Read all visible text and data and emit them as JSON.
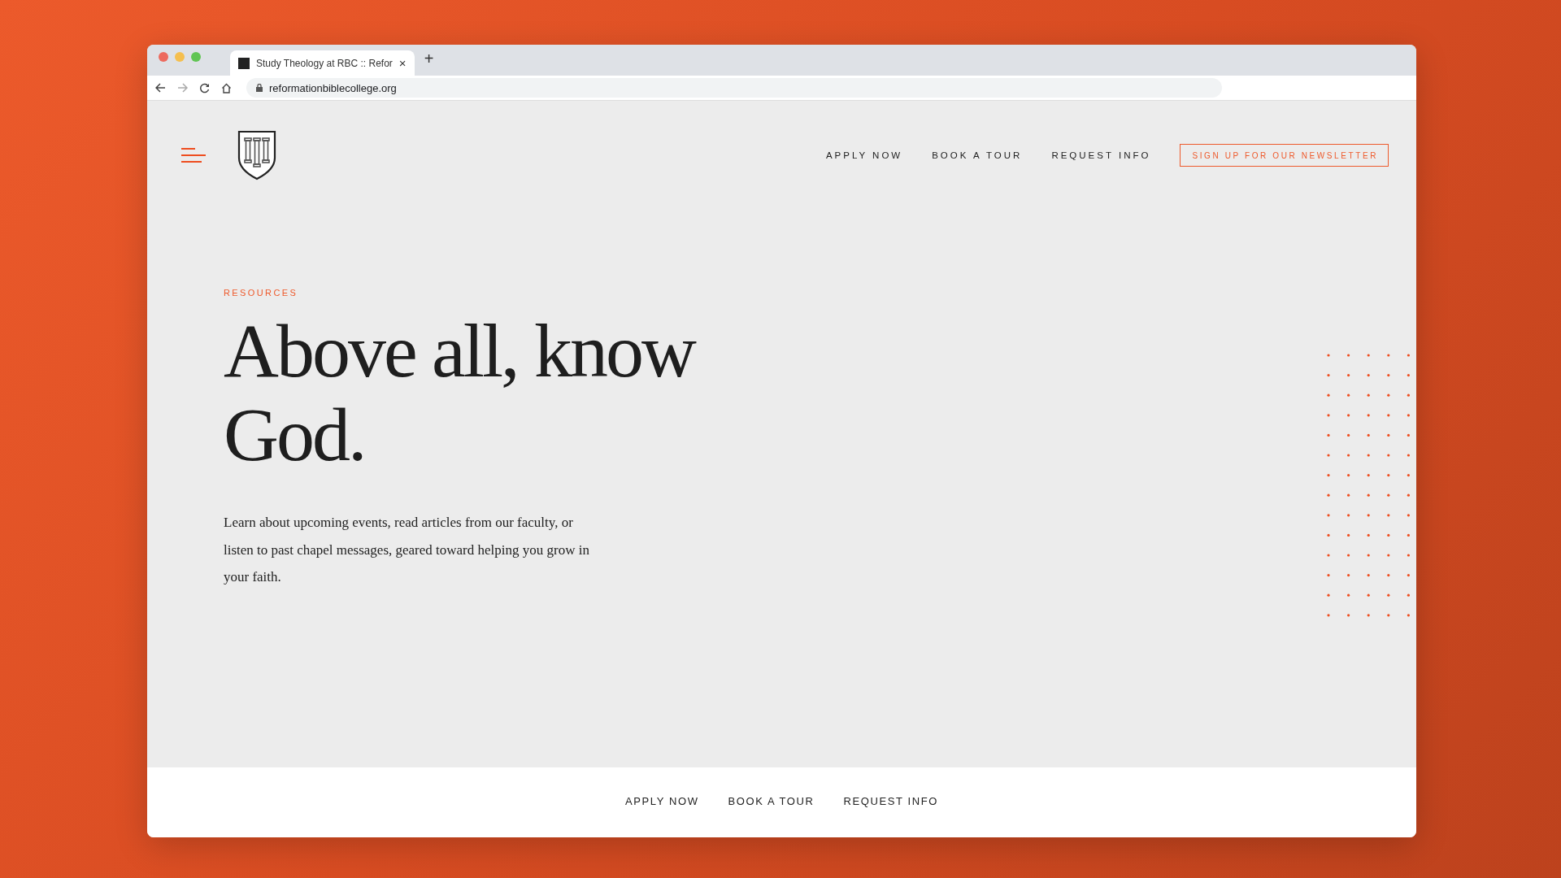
{
  "browser": {
    "tab_title": "Study Theology at RBC :: Refor",
    "tab_close": "×",
    "new_tab": "+",
    "url": "reformationbiblecollege.org"
  },
  "header": {
    "nav": [
      "APPLY NOW",
      "BOOK A TOUR",
      "REQUEST INFO"
    ],
    "newsletter_button": "SIGN UP FOR OUR NEWSLETTER"
  },
  "hero": {
    "eyebrow": "RESOURCES",
    "heading": "Above all, know God.",
    "body": "Learn about upcoming events, read articles from our faculty, or listen to past chapel messages, geared toward helping you grow in your faith."
  },
  "footer_nav": [
    "APPLY NOW",
    "BOOK A TOUR",
    "REQUEST INFO"
  ]
}
